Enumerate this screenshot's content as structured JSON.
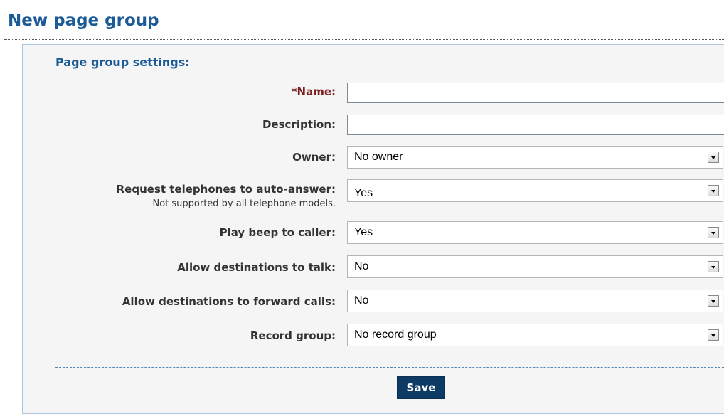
{
  "page": {
    "title": "New page group"
  },
  "form": {
    "section_title": "Page group settings:",
    "name": {
      "label": "*Name:",
      "value": ""
    },
    "description": {
      "label": "Description:",
      "value": ""
    },
    "owner": {
      "label": "Owner:",
      "value": "No owner"
    },
    "auto_answer": {
      "label": "Request telephones to auto-answer:",
      "hint": "Not supported by all telephone models.",
      "value": "Yes"
    },
    "play_beep": {
      "label": "Play beep to caller:",
      "value": "Yes"
    },
    "allow_talk": {
      "label": "Allow destinations to talk:",
      "value": "No"
    },
    "allow_forward": {
      "label": "Allow destinations to forward calls:",
      "value": "No"
    },
    "record_group": {
      "label": "Record group:",
      "value": "No record group"
    },
    "save_label": "Save"
  },
  "colors": {
    "title": "#1a5a96",
    "required_label": "#7b1f1f",
    "save_button": "#0d3b66",
    "panel_background": "#f5f5f5"
  },
  "icons": {
    "select_arrow": "chevron-down-icon"
  }
}
